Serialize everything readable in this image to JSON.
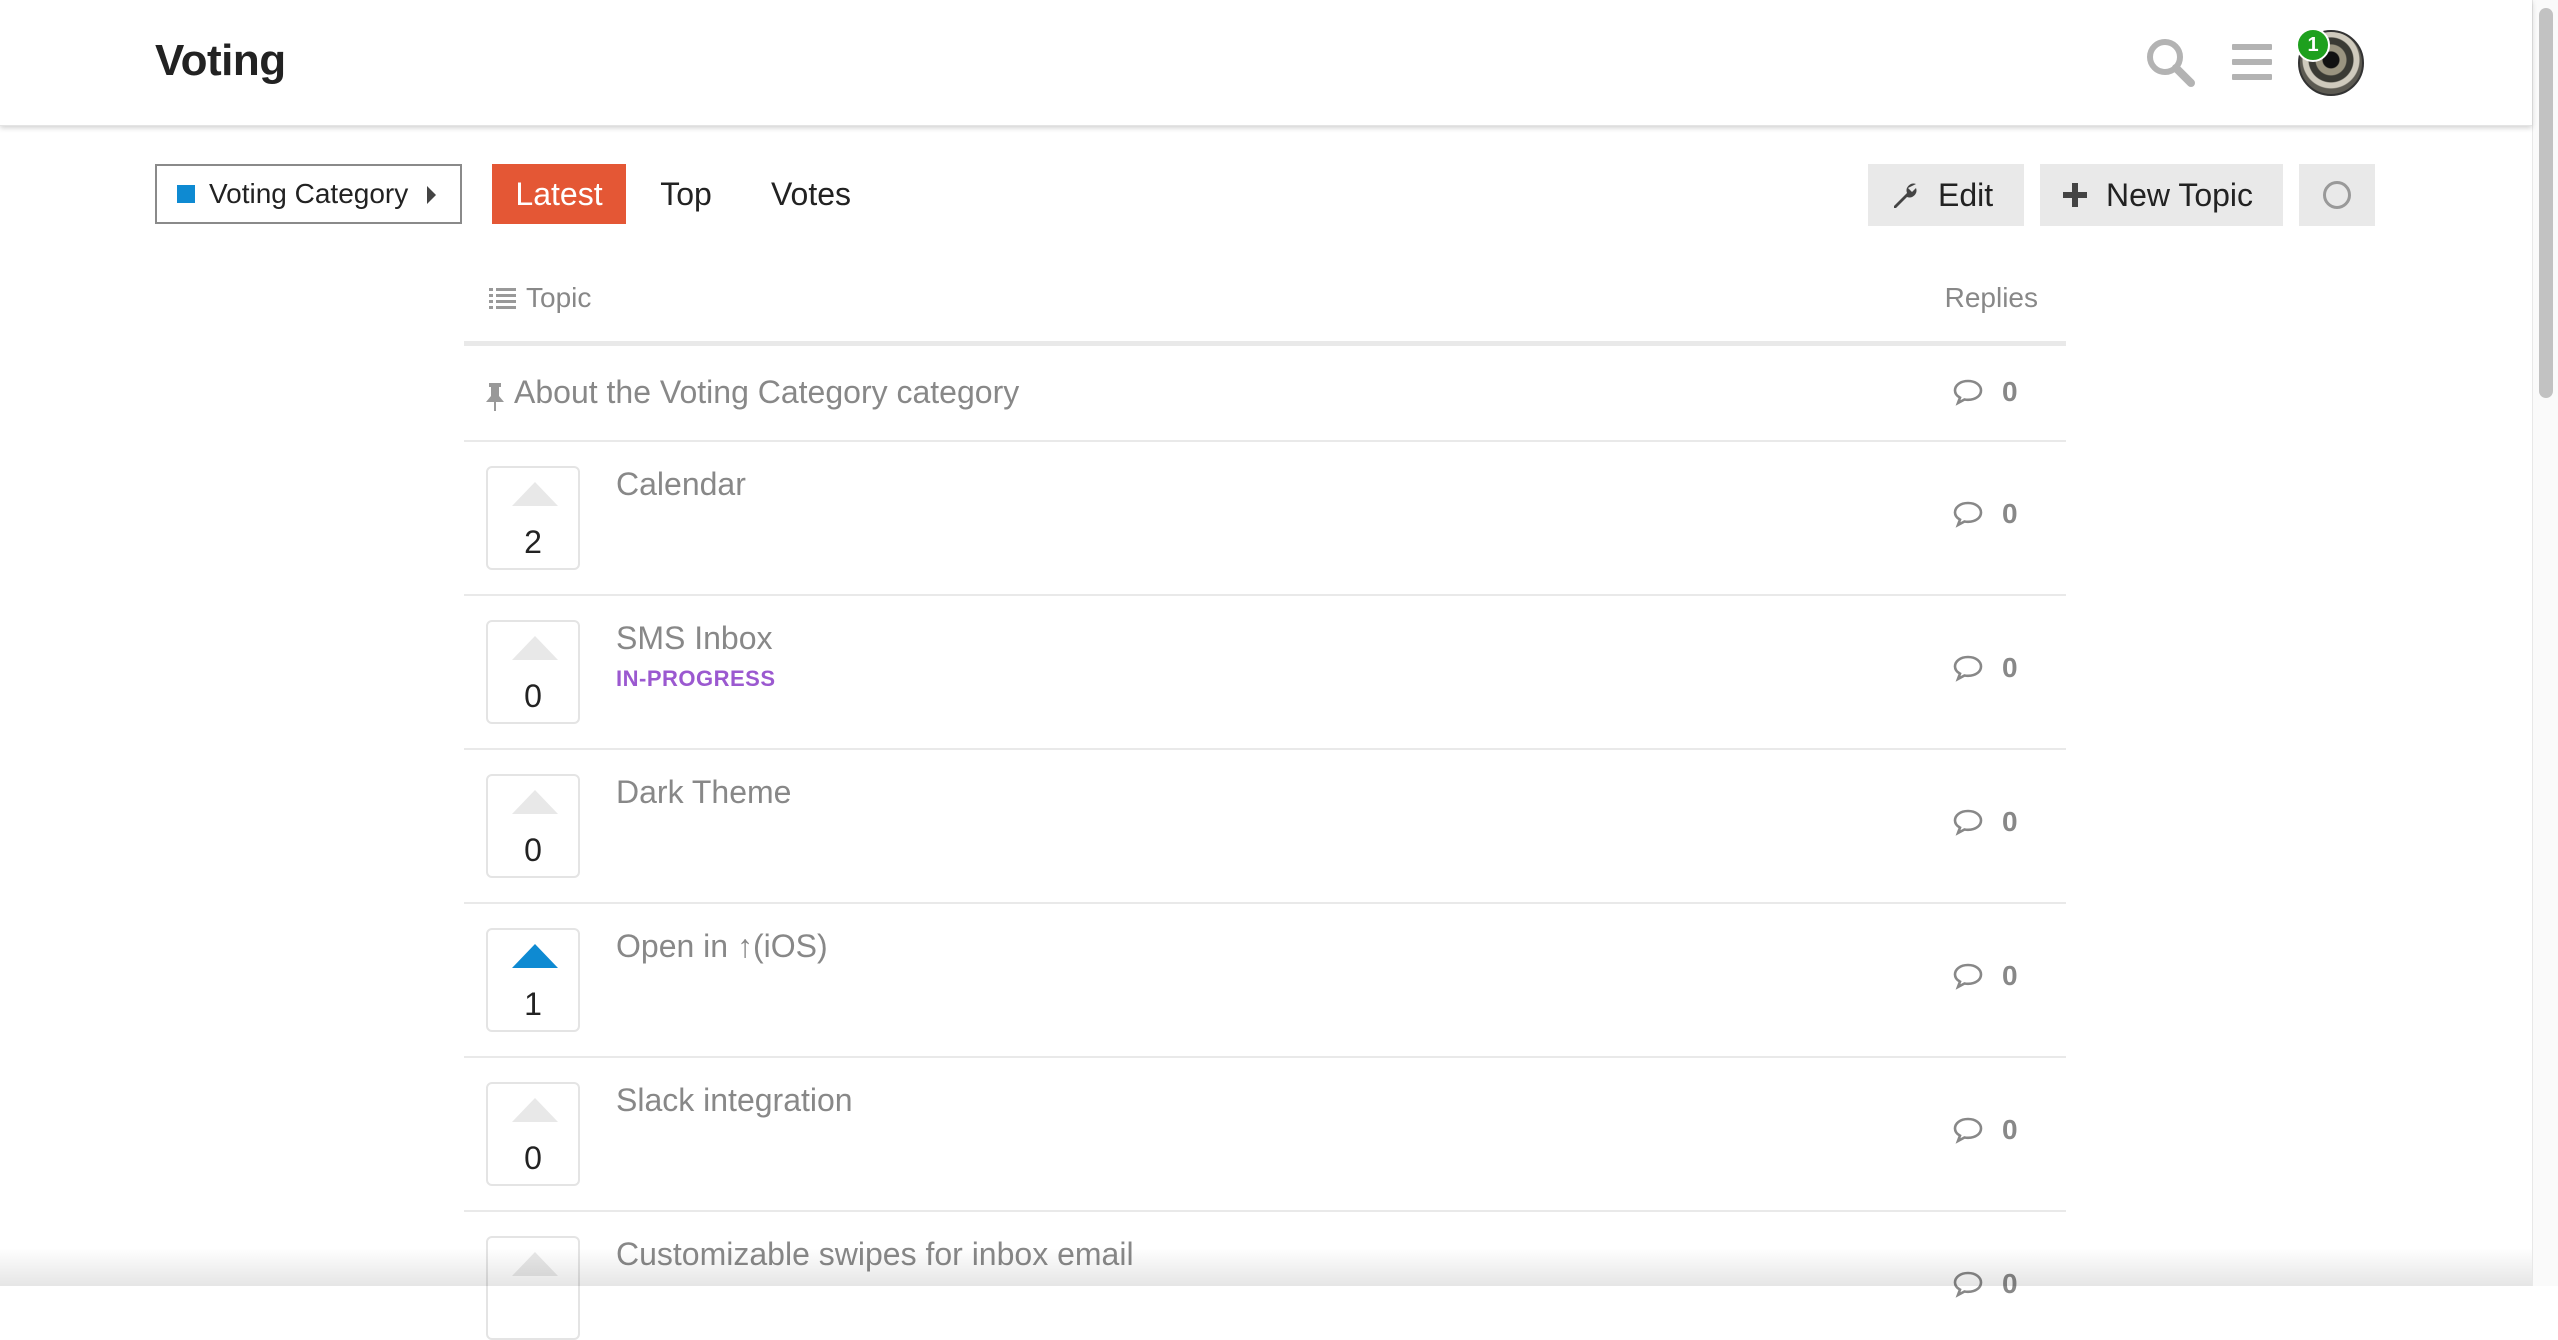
{
  "header": {
    "site_title": "Voting",
    "notification_count": "1",
    "icons": [
      "search-icon",
      "hamburger-menu-icon",
      "avatar"
    ]
  },
  "nav": {
    "category": "Voting Category",
    "category_color": "#0e8ad2",
    "tabs": [
      {
        "label": "Latest",
        "active": true
      },
      {
        "label": "Top",
        "active": false
      },
      {
        "label": "Votes",
        "active": false
      }
    ],
    "active_tab_color": "#e45735",
    "edit_label": "Edit",
    "new_topic_label": "New Topic"
  },
  "list": {
    "col_topic": "Topic",
    "col_replies": "Replies",
    "pinned": {
      "title": "About the Voting Category category",
      "replies": "0"
    },
    "topics": [
      {
        "title": "Calendar",
        "votes": "2",
        "voted": false,
        "tag": "",
        "replies": "0"
      },
      {
        "title": "SMS Inbox",
        "votes": "0",
        "voted": false,
        "tag": "IN-PROGRESS",
        "replies": "0"
      },
      {
        "title": "Dark Theme",
        "votes": "0",
        "voted": false,
        "tag": "",
        "replies": "0"
      },
      {
        "title": "Open in ↑(iOS)",
        "votes": "1",
        "voted": true,
        "tag": "",
        "replies": "0"
      },
      {
        "title": "Slack integration",
        "votes": "0",
        "voted": false,
        "tag": "",
        "replies": "0"
      },
      {
        "title": "Customizable swipes for inbox email",
        "votes": "",
        "voted": false,
        "tag": "",
        "replies": "0"
      }
    ],
    "vote_color": "#0e8ad2",
    "tag_color": "#9b59d0"
  }
}
